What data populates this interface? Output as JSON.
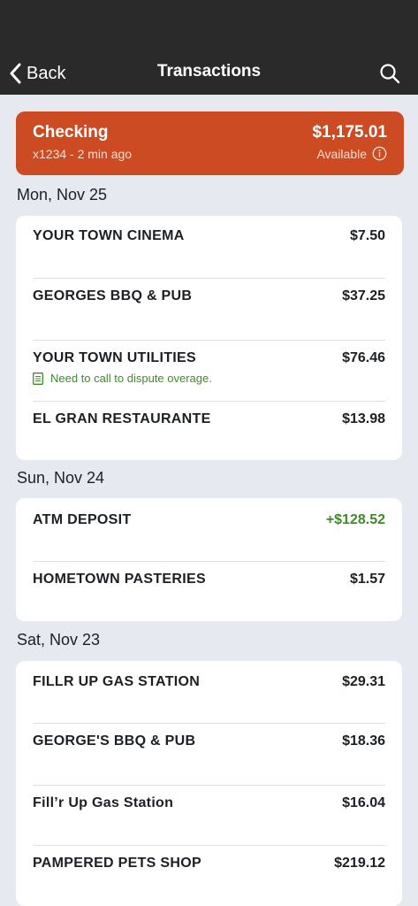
{
  "nav": {
    "back_label": "Back",
    "title": "Transactions",
    "search_icon": "search-icon"
  },
  "account": {
    "name": "Checking",
    "subtitle": "x1234 - 2 min ago",
    "balance": "$1,175.01",
    "balance_label": "Available",
    "accent_color": "#cc4b22"
  },
  "groups": [
    {
      "date": "Mon, Nov 25",
      "transactions": [
        {
          "name": "YOUR TOWN CINEMA",
          "amount": "$7.50"
        },
        {
          "name": "GEORGES BBQ & PUB",
          "amount": "$37.25"
        },
        {
          "name": "YOUR TOWN UTILITIES",
          "amount": "$76.46",
          "note": "Need to call to dispute overage."
        },
        {
          "name": "EL GRAN RESTAURANTE",
          "amount": "$13.98"
        }
      ]
    },
    {
      "date": "Sun, Nov 24",
      "transactions": [
        {
          "name": "ATM DEPOSIT",
          "amount": "+$128.52"
        },
        {
          "name": "HOMETOWN PASTERIES",
          "amount": "$1.57"
        }
      ]
    },
    {
      "date": "Sat, Nov 23",
      "transactions": [
        {
          "name": "FILLR UP GAS STATION",
          "amount": "$29.31"
        },
        {
          "name": "GEORGE'S BBQ & PUB",
          "amount": "$18.36"
        },
        {
          "name": "Fill’r Up Gas Station",
          "amount": "$16.04"
        },
        {
          "name": "PAMPERED PETS SHOP",
          "amount": "$219.12"
        }
      ]
    }
  ]
}
